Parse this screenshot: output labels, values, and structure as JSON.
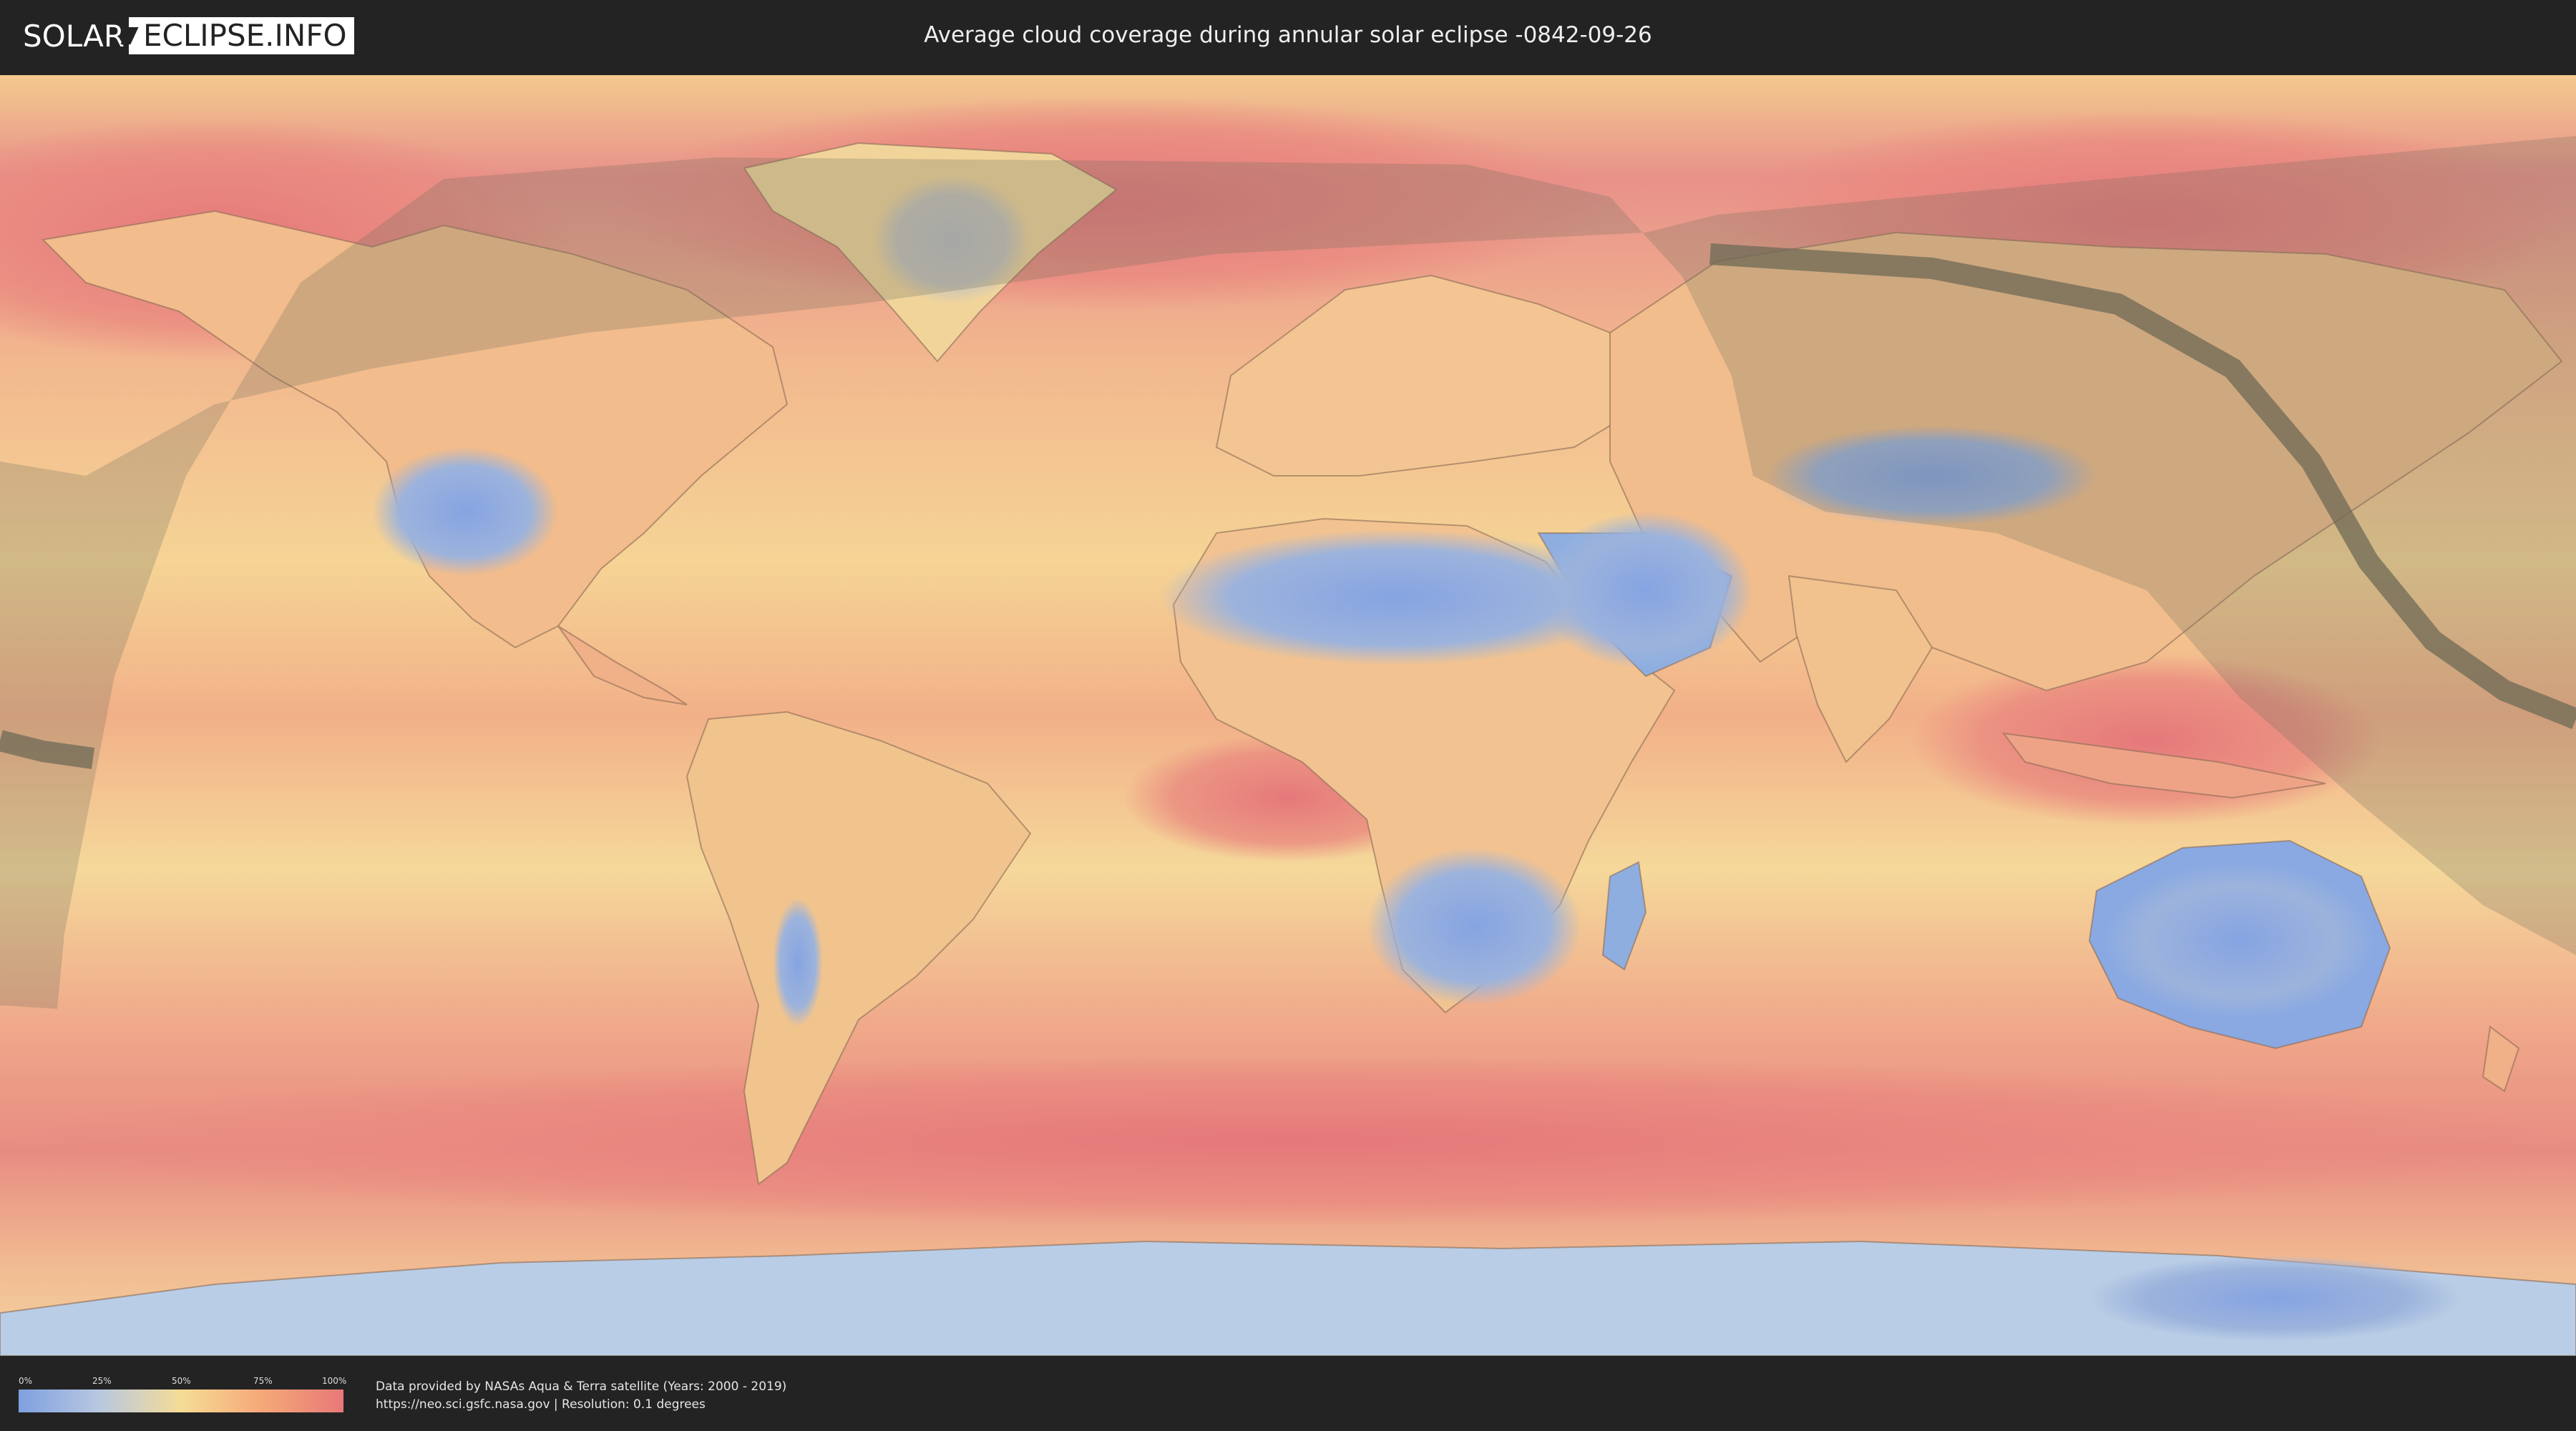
{
  "header": {
    "logo_left": "SOLAR",
    "logo_right": "ECLIPSE.INFO",
    "title": "Average cloud coverage during annular solar eclipse -0842-09-26"
  },
  "legend": {
    "ticks": [
      "0%",
      "25%",
      "50%",
      "75%",
      "100%"
    ],
    "tick_fractions": [
      0,
      0.25,
      0.5,
      0.75,
      1.0
    ],
    "colors": [
      "#7fa0e0",
      "#b8c8e0",
      "#f5dc96",
      "#f5a878",
      "#e87878"
    ]
  },
  "credits": {
    "line1": "Data provided by NASAs Aqua & Terra satellite (Years: 2000 - 2019)",
    "line2": "https://neo.sci.gsfc.nasa.gov | Resolution: 0.1 degrees"
  },
  "map": {
    "projection": "equirectangular",
    "layer": "cloud-coverage",
    "overlays": [
      "eclipse-visibility-shadow",
      "annular-path-band"
    ]
  }
}
